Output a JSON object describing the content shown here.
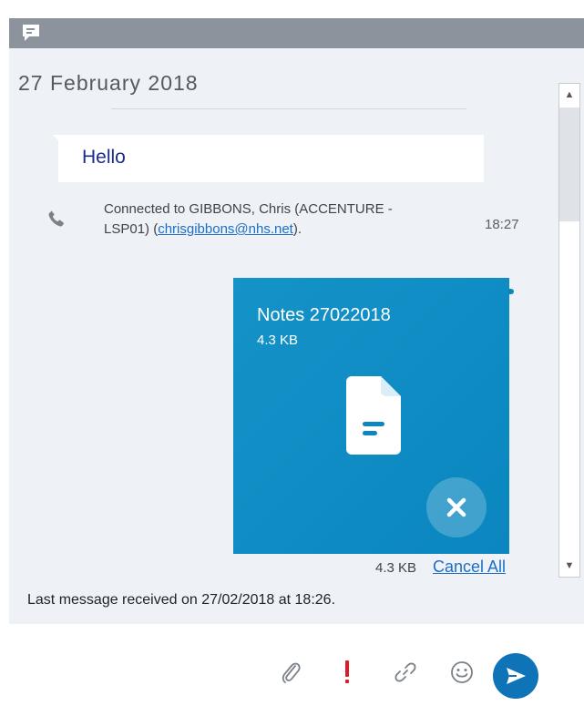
{
  "window": {
    "titlebar_color": "#8d939c",
    "icon": "chat-icon"
  },
  "conversation": {
    "date_header": "27 February 2018",
    "hello_message": "Hello",
    "connection": {
      "prefix": "Connected to GIBBONS, Chris (ACCENTURE - LSP01) (",
      "email": "chrisgibbons@nhs.net",
      "suffix": ").",
      "time": "18:27"
    },
    "file_transfer": {
      "file_name": "Notes 27022018",
      "file_size": "4.3 KB",
      "card_color": "#0b86c0",
      "file_icon": "document-icon",
      "cancel_icon": "close-icon"
    },
    "total_size": "4.3 KB",
    "cancel_all_label": "Cancel All",
    "last_message": "Last message received on 27/02/2018 at 18:26."
  },
  "scrollbar": {
    "up_icon": "▲",
    "down_icon": "▼"
  },
  "compose": {
    "input_value": "",
    "icons": [
      "paperclip-icon",
      "exclamation-icon",
      "link-icon",
      "emoji-icon",
      "send-icon"
    ],
    "send_color": "#0f73b8",
    "importance_color": "#e01b24"
  }
}
